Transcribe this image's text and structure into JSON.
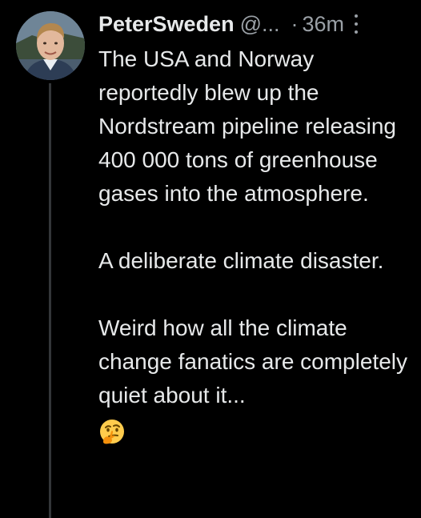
{
  "tweet": {
    "display_name": "PeterSweden",
    "handle": "@...",
    "separator": "·",
    "time": "36m",
    "paragraphs": [
      "The USA and Norway reportedly blew up the Nordstream pipeline releasing 400 000 tons of greenhouse gases into the atmosphere.",
      "A deliberate climate disaster.",
      "Weird how all the climate change fanatics are completely quiet about it..."
    ],
    "trailing_emoji": "thinking-face-icon"
  },
  "colors": {
    "background": "#000000",
    "text_primary": "#e7e9ea",
    "text_secondary": "#9aa0a6",
    "thread_line": "#333639"
  }
}
